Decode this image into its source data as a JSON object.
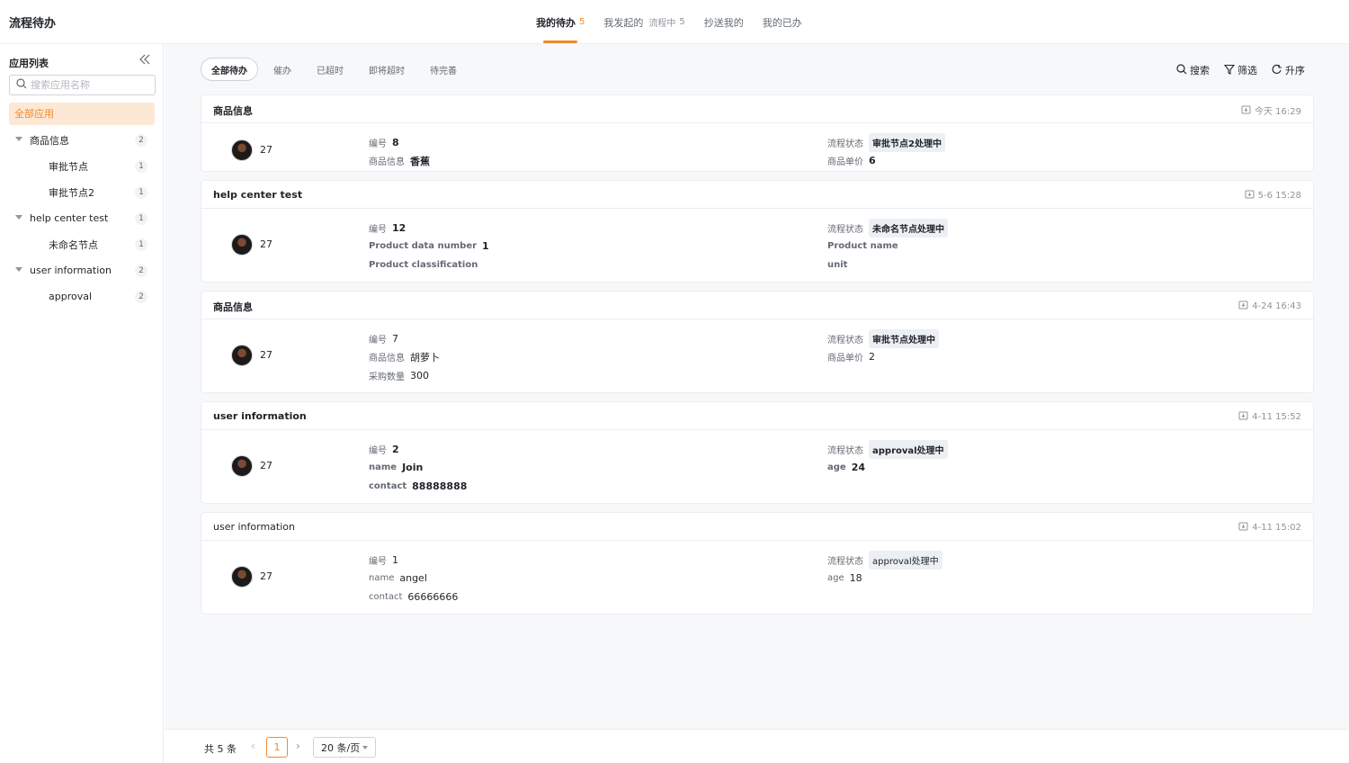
{
  "app_title": "流程待办",
  "top_tabs": [
    {
      "label": "我的待办",
      "count": "5",
      "sub": ""
    },
    {
      "label": "我发起的",
      "count": "5",
      "sub": "流程中"
    },
    {
      "label": "抄送我的",
      "count": "",
      "sub": ""
    },
    {
      "label": "我的已办",
      "count": "",
      "sub": ""
    }
  ],
  "sidebar": {
    "title": "应用列表",
    "search_placeholder": "搜索应用名称",
    "all_label": "全部应用",
    "tree": [
      {
        "label": "商品信息",
        "count": "2"
      },
      {
        "label": "审批节点",
        "count": "1"
      },
      {
        "label": "审批节点2",
        "count": "1"
      },
      {
        "label": "help center test",
        "count": "1"
      },
      {
        "label": "未命名节点",
        "count": "1"
      },
      {
        "label": "user information",
        "count": "2"
      },
      {
        "label": "approval",
        "count": "2"
      }
    ]
  },
  "filter_tabs": [
    "全部待办",
    "催办",
    "已超时",
    "即将超时",
    "待完善"
  ],
  "tools": {
    "search": "搜索",
    "filter": "筛选",
    "sort": "升序"
  },
  "cards": [
    {
      "title": "商品信息",
      "time": "今天 16:29",
      "user": "27",
      "left": [
        {
          "k": "编号",
          "v": "8"
        },
        {
          "k": "商品信息",
          "v": "香蕉"
        }
      ],
      "status_label": "流程状态",
      "status": "审批节点2处理中",
      "right": [
        {
          "k": "商品单价",
          "v": "6"
        }
      ]
    },
    {
      "title": "help center test",
      "time": "5-6 15:28",
      "user": "27",
      "left": [
        {
          "k": "编号",
          "v": "12"
        },
        {
          "k": "Product data number",
          "v": "1"
        },
        {
          "k": "Product classification",
          "v": ""
        }
      ],
      "status_label": "流程状态",
      "status": "未命名节点处理中",
      "right": [
        {
          "k": "Product name",
          "v": ""
        },
        {
          "k": "unit",
          "v": ""
        }
      ]
    },
    {
      "title": "商品信息",
      "time": "4-24 16:43",
      "user": "27",
      "left": [
        {
          "k": "编号",
          "v": "7"
        },
        {
          "k": "商品信息",
          "v": "胡萝卜"
        },
        {
          "k": "采购数量",
          "v": "300"
        }
      ],
      "status_label": "流程状态",
      "status": "审批节点处理中",
      "right": [
        {
          "k": "商品单价",
          "v": "2"
        }
      ]
    },
    {
      "title": "user information",
      "time": "4-11 15:52",
      "user": "27",
      "left": [
        {
          "k": "编号",
          "v": "2"
        },
        {
          "k": "name",
          "v": "Join"
        },
        {
          "k": "contact",
          "v": "88888888"
        }
      ],
      "status_label": "流程状态",
      "status": "approval处理中",
      "right": [
        {
          "k": "age",
          "v": "24"
        }
      ]
    },
    {
      "title": "user information",
      "time": "4-11 15:02",
      "user": "27",
      "left": [
        {
          "k": "编号",
          "v": "1"
        },
        {
          "k": "name",
          "v": "angel"
        },
        {
          "k": "contact",
          "v": "66666666"
        }
      ],
      "status_label": "流程状态",
      "status": "approval处理中",
      "right": [
        {
          "k": "age",
          "v": "18"
        }
      ]
    }
  ],
  "footer": {
    "total": "共 5 条",
    "prev": "‹",
    "page": "1",
    "next": "›",
    "page_size": "20 条/页"
  }
}
